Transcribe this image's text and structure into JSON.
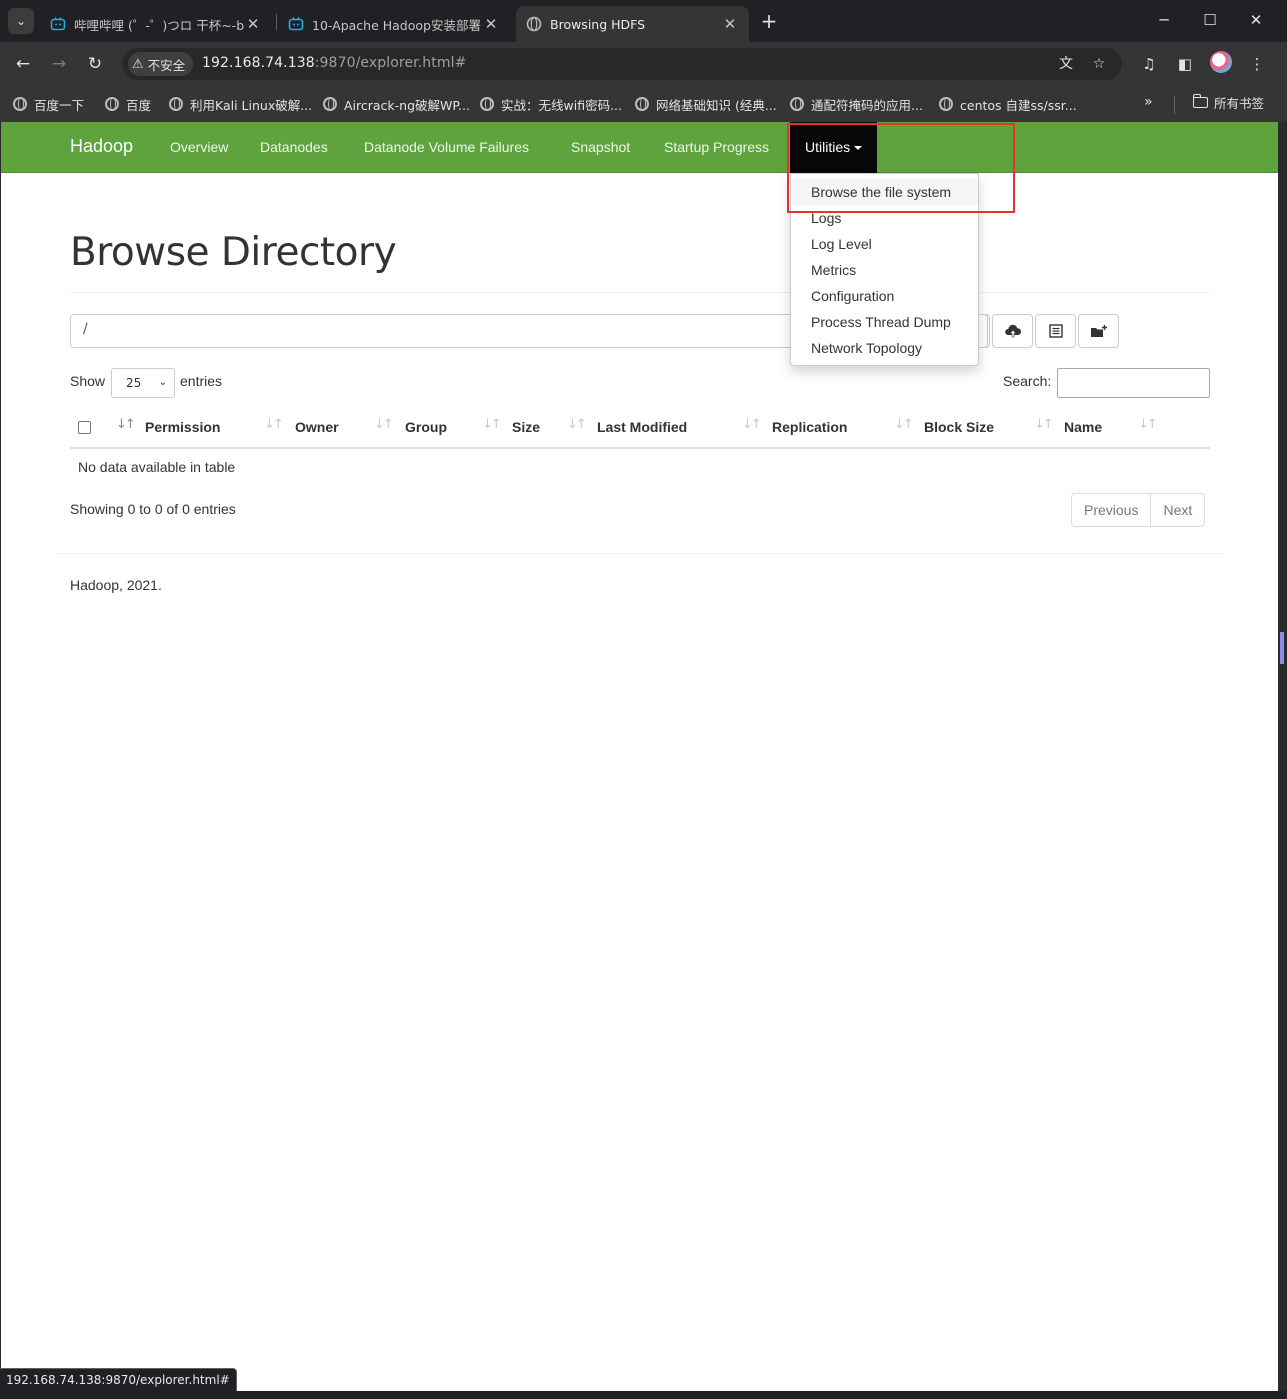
{
  "browser": {
    "tabs": [
      {
        "title": "哔哩哔哩 (゜-゜)つロ 干杯~-bilibili",
        "active": false
      },
      {
        "title": "10-Apache Hadoop安装部署",
        "active": false
      },
      {
        "title": "Browsing HDFS",
        "active": true
      }
    ],
    "security_label": "不安全",
    "url_host": "192.168.74.138",
    "url_rest": ":9870/explorer.html#",
    "bookmarks": [
      "百度一下",
      "百度",
      "利用Kali Linux破解...",
      "Aircrack-ng破解WP...",
      "实战：无线wifi密码...",
      "网络基础知识 (经典...",
      "通配符掩码的应用...",
      "centos 自建ss/ssr..."
    ],
    "all_bookmarks_label": "所有书签",
    "status_url": "192.168.74.138:9870/explorer.html#"
  },
  "navbar": {
    "brand": "Hadoop",
    "links": [
      "Overview",
      "Datanodes",
      "Datanode Volume Failures",
      "Snapshot",
      "Startup Progress"
    ],
    "utilities_label": "Utilities"
  },
  "utilities_menu": [
    "Browse the file system",
    "Logs",
    "Log Level",
    "Metrics",
    "Configuration",
    "Process Thread Dump",
    "Network Topology"
  ],
  "page": {
    "title": "Browse Directory",
    "path_value": "/",
    "show_label": "Show",
    "entries_select": "25",
    "entries_label": "entries",
    "search_label": "Search:",
    "columns": [
      "Permission",
      "Owner",
      "Group",
      "Size",
      "Last Modified",
      "Replication",
      "Block Size",
      "Name"
    ],
    "empty_message": "No data available in table",
    "showing": "Showing 0 to 0 of 0 entries",
    "previous": "Previous",
    "next": "Next",
    "footer": "Hadoop, 2021."
  },
  "colors": {
    "navbar_green": "#5fa33e",
    "dropdown_active": "#080808",
    "annotation_red": "#e3342f"
  },
  "icons": [
    "upload-icon",
    "list-icon",
    "new-folder-icon"
  ]
}
